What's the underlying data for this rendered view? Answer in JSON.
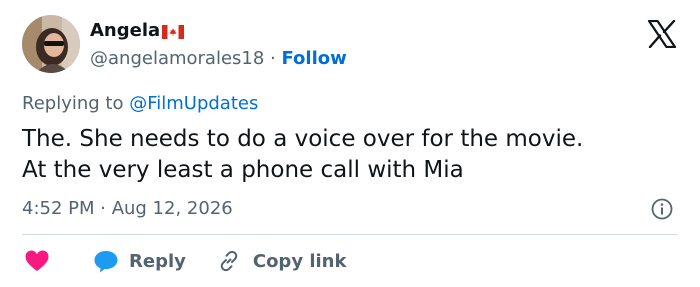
{
  "author": {
    "name": "Angela",
    "handle": "@angelamorales18",
    "separator": " · ",
    "follow_label": "Follow",
    "avatar": "avatar-photo",
    "flag": "canada-flag-icon"
  },
  "header": {
    "logo": "x-logo-icon"
  },
  "reply_context": {
    "prefix": "Replying to ",
    "mention": "@FilmUpdates"
  },
  "tweet": {
    "lines": [
      "The. She needs to do a voice over for the movie.",
      "At the very least a phone call with Mia"
    ]
  },
  "meta": {
    "timestamp": "4:52 PM · Aug 12, 2026",
    "info_icon": "info-icon"
  },
  "actions": {
    "like_icon": "heart-icon",
    "reply_label": "Reply",
    "reply_icon": "reply-bubble-icon",
    "copy_label": "Copy link",
    "copy_icon": "link-icon"
  },
  "colors": {
    "accent": "#006fd6",
    "secondary_text": "#536471",
    "primary_text": "#0f1419",
    "like": "#f91880",
    "reply": "#1d9bf0",
    "divider": "#cfd9de"
  }
}
